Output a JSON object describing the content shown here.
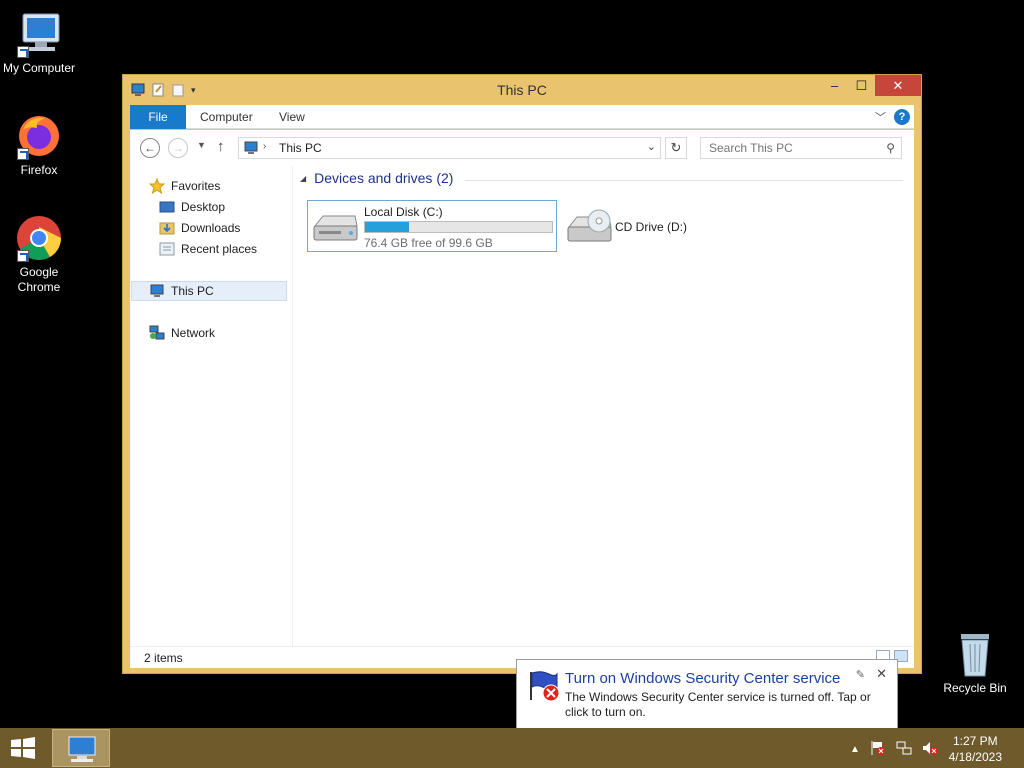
{
  "desktop": {
    "icons": [
      {
        "label": "My Computer"
      },
      {
        "label": "Firefox"
      },
      {
        "label": "Google Chrome"
      },
      {
        "label": "Recycle Bin"
      }
    ]
  },
  "window": {
    "title": "This PC",
    "controls": {
      "minimize": "–",
      "maximize": "☐",
      "close": "✕"
    },
    "ribbon_tabs": [
      "File",
      "Computer",
      "View"
    ],
    "address": {
      "crumb": "This PC",
      "sep": "›"
    },
    "search": {
      "placeholder": "Search This PC"
    },
    "nav": {
      "favorites": "Favorites",
      "desktop": "Desktop",
      "downloads": "Downloads",
      "recent": "Recent places",
      "this_pc": "This PC",
      "network": "Network"
    },
    "group_title": "Devices and drives (2)",
    "drives": [
      {
        "name": "Local Disk (C:)",
        "free_text": "76.4 GB free of 99.6 GB",
        "used_fraction": 0.233
      },
      {
        "name": "CD Drive (D:)"
      }
    ],
    "status": "2 items"
  },
  "toast": {
    "title": "Turn on Windows Security Center service",
    "body": "The Windows Security Center service is turned off. Tap or click to turn on."
  },
  "taskbar": {
    "time": "1:27 PM",
    "date": "4/18/2023"
  },
  "colors": {
    "window_frame": "#e9c36e",
    "accent": "#1979ca",
    "taskbar": "#6e5a2b",
    "close": "#c7463b"
  }
}
